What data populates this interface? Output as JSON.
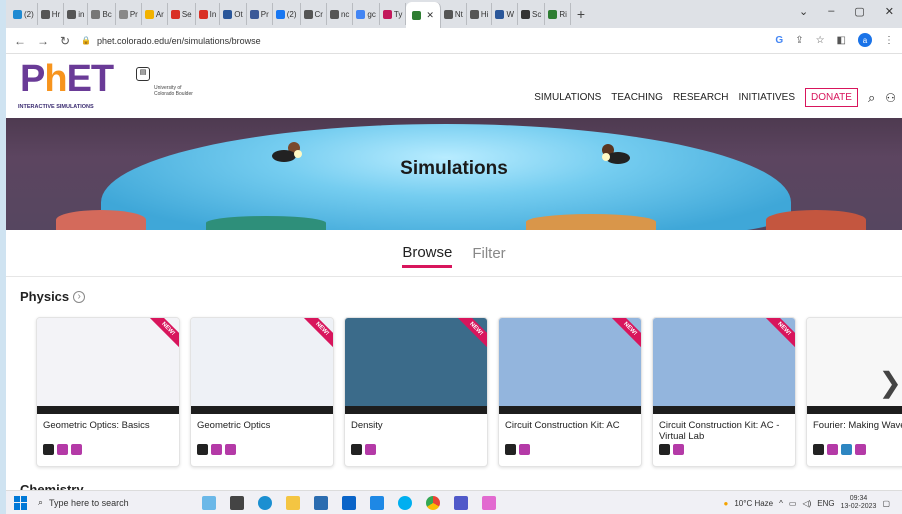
{
  "browser": {
    "tabs": [
      {
        "label": "(2)",
        "color": "#1f8ad2"
      },
      {
        "label": "Hr",
        "color": "#555"
      },
      {
        "label": "in",
        "color": "#555"
      },
      {
        "label": "Bc",
        "color": "#777"
      },
      {
        "label": "Pr",
        "color": "#888"
      },
      {
        "label": "Ar",
        "color": "#f2b200"
      },
      {
        "label": "Se",
        "color": "#d93025"
      },
      {
        "label": "In",
        "color": "#d93025"
      },
      {
        "label": "Ot",
        "color": "#2b579a"
      },
      {
        "label": "Pr",
        "color": "#3b5998"
      },
      {
        "label": "(2)",
        "color": "#1877f2"
      },
      {
        "label": "Cr",
        "color": "#555"
      },
      {
        "label": "nc",
        "color": "#555"
      },
      {
        "label": "gc",
        "color": "#4285f4"
      },
      {
        "label": "Ty",
        "color": "#c2185b"
      },
      {
        "label": "",
        "color": "#2e7d32",
        "active": true
      },
      {
        "label": "Nt",
        "color": "#555"
      },
      {
        "label": "Hi",
        "color": "#555"
      },
      {
        "label": "W",
        "color": "#2b579a"
      },
      {
        "label": "Sc",
        "color": "#333"
      },
      {
        "label": "Ri",
        "color": "#2e7d32"
      }
    ],
    "url": "phet.colorado.edu/en/simulations/browse"
  },
  "site": {
    "logo_sub": "INTERACTIVE SIMULATIONS",
    "university": "University of Colorado Boulder",
    "menu": [
      "SIMULATIONS",
      "TEACHING",
      "RESEARCH",
      "INITIATIVES"
    ],
    "donate": "DONATE",
    "hero_title": "Simulations",
    "view_tabs": {
      "browse": "Browse",
      "filter": "Filter"
    },
    "section_physics": "Physics",
    "section_chemistry": "Chemistry",
    "ribbon": "NEW!"
  },
  "cards": [
    {
      "title": "Geometric Optics: Basics",
      "badges": [
        "html",
        "purple",
        "purple"
      ],
      "thumb": "#f3f3f7",
      "new": true
    },
    {
      "title": "Geometric Optics",
      "badges": [
        "html",
        "purple",
        "purple"
      ],
      "thumb": "#eef1f6",
      "new": true
    },
    {
      "title": "Density",
      "badges": [
        "html",
        "purple"
      ],
      "thumb": "#3b6b8a",
      "new": true
    },
    {
      "title": "Circuit Construction Kit: AC",
      "badges": [
        "html",
        "purple"
      ],
      "thumb": "#93b5dd",
      "new": true
    },
    {
      "title": "Circuit Construction Kit: AC - Virtual Lab",
      "badges": [
        "html",
        "purple"
      ],
      "thumb": "#93b5dd",
      "new": true
    },
    {
      "title": "Fourier: Making Waves",
      "badges": [
        "html",
        "purple",
        "blue",
        "purple"
      ],
      "thumb": "#f7f7f7",
      "new": false
    }
  ],
  "taskbar": {
    "search_placeholder": "Type here to search",
    "weather": "10°C Haze",
    "lang": "ENG",
    "time": "09:34",
    "date": "13-02-2023"
  }
}
